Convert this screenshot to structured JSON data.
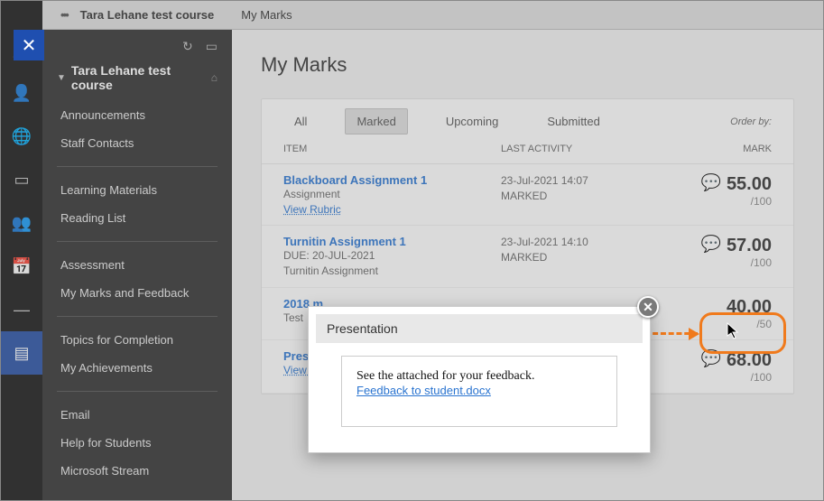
{
  "breadcrumb": {
    "course": "Tara Lehane test course",
    "page": "My Marks"
  },
  "close_label": "✕",
  "sidebar": {
    "course_title": "Tara Lehane test course",
    "groups": [
      [
        "Announcements",
        "Staff Contacts"
      ],
      [
        "Learning Materials",
        "Reading List"
      ],
      [
        "Assessment",
        "My Marks and Feedback"
      ],
      [
        "Topics for Completion",
        "My Achievements"
      ],
      [
        "Email",
        "Help for Students",
        "Microsoft Stream"
      ]
    ]
  },
  "page_title": "My Marks",
  "tabs": {
    "all": "All",
    "marked": "Marked",
    "upcoming": "Upcoming",
    "submitted": "Submitted"
  },
  "order_by_label": "Order by:",
  "columns": {
    "item": "ITEM",
    "activity": "LAST ACTIVITY",
    "mark": "MARK"
  },
  "rows": [
    {
      "title": "Blackboard Assignment 1",
      "sub": "Assignment",
      "link": "View Rubric",
      "activity_line1": "23-Jul-2021 14:07",
      "activity_line2": "MARKED",
      "mark": "55.00",
      "total": "/100",
      "bubble": true
    },
    {
      "title": "Turnitin Assignment 1",
      "sub": "DUE: 20-JUL-2021",
      "sub2": "Turnitin Assignment",
      "activity_line1": "23-Jul-2021 14:10",
      "activity_line2": "MARKED",
      "mark": "57.00",
      "total": "/100",
      "bubble": true
    },
    {
      "title": "2018 m",
      "sub": "Test",
      "mark": "40.00",
      "total": "/50",
      "bubble": false
    },
    {
      "title": "Present",
      "link": "View R",
      "mark": "68.00",
      "total": "/100",
      "bubble": true
    }
  ],
  "modal": {
    "title": "Presentation",
    "message": "See the attached for your feedback.",
    "file": "Feedback to student.docx"
  }
}
